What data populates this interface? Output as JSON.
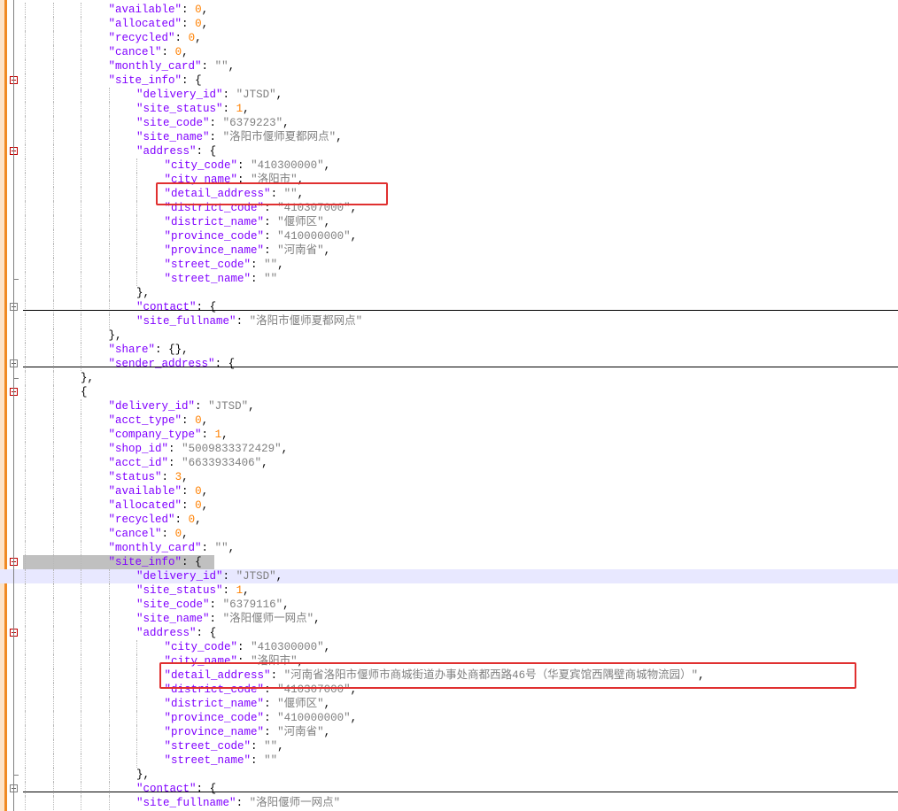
{
  "editor": {
    "lines": [
      {
        "indent": 3,
        "key": "available",
        "value": "0",
        "vtype": "n",
        "trail": ","
      },
      {
        "indent": 3,
        "key": "allocated",
        "value": "0",
        "vtype": "n",
        "trail": ","
      },
      {
        "indent": 3,
        "key": "recycled",
        "value": "0",
        "vtype": "n",
        "trail": ","
      },
      {
        "indent": 3,
        "key": "cancel",
        "value": "0",
        "vtype": "n",
        "trail": ","
      },
      {
        "indent": 3,
        "key": "monthly_card",
        "value": "\"\"",
        "vtype": "s",
        "trail": ","
      },
      {
        "indent": 3,
        "key": "site_info",
        "value": "{",
        "vtype": "p",
        "trail": "",
        "fold": "minus"
      },
      {
        "indent": 4,
        "key": "delivery_id",
        "value": "\"JTSD\"",
        "vtype": "s",
        "trail": ","
      },
      {
        "indent": 4,
        "key": "site_status",
        "value": "1",
        "vtype": "n",
        "trail": ","
      },
      {
        "indent": 4,
        "key": "site_code",
        "value": "\"6379223\"",
        "vtype": "s",
        "trail": ","
      },
      {
        "indent": 4,
        "key": "site_name",
        "value": "\"洛阳市偃师夏都网点\"",
        "vtype": "s",
        "trail": ","
      },
      {
        "indent": 4,
        "key": "address",
        "value": "{",
        "vtype": "p",
        "trail": "",
        "fold": "minus"
      },
      {
        "indent": 5,
        "key": "city_code",
        "value": "\"410300000\"",
        "vtype": "s",
        "trail": ","
      },
      {
        "indent": 5,
        "key": "city_name",
        "value": "\"洛阳市\"",
        "vtype": "s",
        "trail": ","
      },
      {
        "indent": 5,
        "key": "detail_address",
        "value": "\"\"",
        "vtype": "s",
        "trail": ","
      },
      {
        "indent": 5,
        "key": "district_code",
        "value": "\"410307000\"",
        "vtype": "s",
        "trail": ","
      },
      {
        "indent": 5,
        "key": "district_name",
        "value": "\"偃师区\"",
        "vtype": "s",
        "trail": ","
      },
      {
        "indent": 5,
        "key": "province_code",
        "value": "\"410000000\"",
        "vtype": "s",
        "trail": ","
      },
      {
        "indent": 5,
        "key": "province_name",
        "value": "\"河南省\"",
        "vtype": "s",
        "trail": ","
      },
      {
        "indent": 5,
        "key": "street_code",
        "value": "\"\"",
        "vtype": "s",
        "trail": ","
      },
      {
        "indent": 5,
        "key": "street_name",
        "value": "\"\"",
        "vtype": "s",
        "trail": "",
        "foldend": true
      },
      {
        "indent": 4,
        "raw": "},"
      },
      {
        "indent": 4,
        "key": "contact",
        "value": "{",
        "vtype": "p",
        "trail": "",
        "fold": "plus",
        "rule": true
      },
      {
        "indent": 4,
        "key": "site_fullname",
        "value": "\"洛阳市偃师夏都网点\"",
        "vtype": "s",
        "trail": ""
      },
      {
        "indent": 3,
        "raw": "},"
      },
      {
        "indent": 3,
        "key": "share",
        "value": "{}",
        "vtype": "p",
        "trail": ","
      },
      {
        "indent": 3,
        "key": "sender_address",
        "value": "{",
        "vtype": "p",
        "trail": "",
        "fold": "plus",
        "rule": true
      },
      {
        "indent": 2,
        "raw": "},",
        "foldend": true
      },
      {
        "indent": 2,
        "raw": "{",
        "fold": "minus"
      },
      {
        "indent": 3,
        "key": "delivery_id",
        "value": "\"JTSD\"",
        "vtype": "s",
        "trail": ","
      },
      {
        "indent": 3,
        "key": "acct_type",
        "value": "0",
        "vtype": "n",
        "trail": ","
      },
      {
        "indent": 3,
        "key": "company_type",
        "value": "1",
        "vtype": "n",
        "trail": ","
      },
      {
        "indent": 3,
        "key": "shop_id",
        "value": "\"5009833372429\"",
        "vtype": "s",
        "trail": ","
      },
      {
        "indent": 3,
        "key": "acct_id",
        "value": "\"6633933406\"",
        "vtype": "s",
        "trail": ","
      },
      {
        "indent": 3,
        "key": "status",
        "value": "3",
        "vtype": "n",
        "trail": ","
      },
      {
        "indent": 3,
        "key": "available",
        "value": "0",
        "vtype": "n",
        "trail": ","
      },
      {
        "indent": 3,
        "key": "allocated",
        "value": "0",
        "vtype": "n",
        "trail": ","
      },
      {
        "indent": 3,
        "key": "recycled",
        "value": "0",
        "vtype": "n",
        "trail": ","
      },
      {
        "indent": 3,
        "key": "cancel",
        "value": "0",
        "vtype": "n",
        "trail": ","
      },
      {
        "indent": 3,
        "key": "monthly_card",
        "value": "\"\"",
        "vtype": "s",
        "trail": ","
      },
      {
        "indent": 3,
        "key": "site_info",
        "value": "{",
        "vtype": "p",
        "trail": "",
        "fold": "minus",
        "selected": true
      },
      {
        "indent": 4,
        "key": "delivery_id",
        "value": "\"JTSD\"",
        "vtype": "s",
        "trail": ",",
        "current": true
      },
      {
        "indent": 4,
        "key": "site_status",
        "value": "1",
        "vtype": "n",
        "trail": ","
      },
      {
        "indent": 4,
        "key": "site_code",
        "value": "\"6379116\"",
        "vtype": "s",
        "trail": ","
      },
      {
        "indent": 4,
        "key": "site_name",
        "value": "\"洛阳偃师一网点\"",
        "vtype": "s",
        "trail": ","
      },
      {
        "indent": 4,
        "key": "address",
        "value": "{",
        "vtype": "p",
        "trail": "",
        "fold": "minus"
      },
      {
        "indent": 5,
        "key": "city_code",
        "value": "\"410300000\"",
        "vtype": "s",
        "trail": ","
      },
      {
        "indent": 5,
        "key": "city_name",
        "value": "\"洛阳市\"",
        "vtype": "s",
        "trail": ","
      },
      {
        "indent": 5,
        "key": "detail_address",
        "value": "\"河南省洛阳市偃师市商城街道办事处商都西路46号（华夏宾馆西隅壁商城物流园）\"",
        "vtype": "s",
        "trail": ","
      },
      {
        "indent": 5,
        "key": "district_code",
        "value": "\"410307000\"",
        "vtype": "s",
        "trail": ","
      },
      {
        "indent": 5,
        "key": "district_name",
        "value": "\"偃师区\"",
        "vtype": "s",
        "trail": ","
      },
      {
        "indent": 5,
        "key": "province_code",
        "value": "\"410000000\"",
        "vtype": "s",
        "trail": ","
      },
      {
        "indent": 5,
        "key": "province_name",
        "value": "\"河南省\"",
        "vtype": "s",
        "trail": ","
      },
      {
        "indent": 5,
        "key": "street_code",
        "value": "\"\"",
        "vtype": "s",
        "trail": ","
      },
      {
        "indent": 5,
        "key": "street_name",
        "value": "\"\"",
        "vtype": "s",
        "trail": ""
      },
      {
        "indent": 4,
        "raw": "},",
        "foldend": true
      },
      {
        "indent": 4,
        "key": "contact",
        "value": "{",
        "vtype": "p",
        "trail": "",
        "fold": "plus",
        "rule": true
      },
      {
        "indent": 4,
        "key": "site_fullname",
        "value": "\"洛阳偃师一网点\"",
        "vtype": "s",
        "trail": ""
      }
    ]
  },
  "colors": {
    "key": "#8000ff",
    "string": "#808080",
    "number": "#ff8000",
    "highlight_box": "#e03030",
    "change_bar": "#f08a24",
    "current_line": "#e8e8ff"
  }
}
